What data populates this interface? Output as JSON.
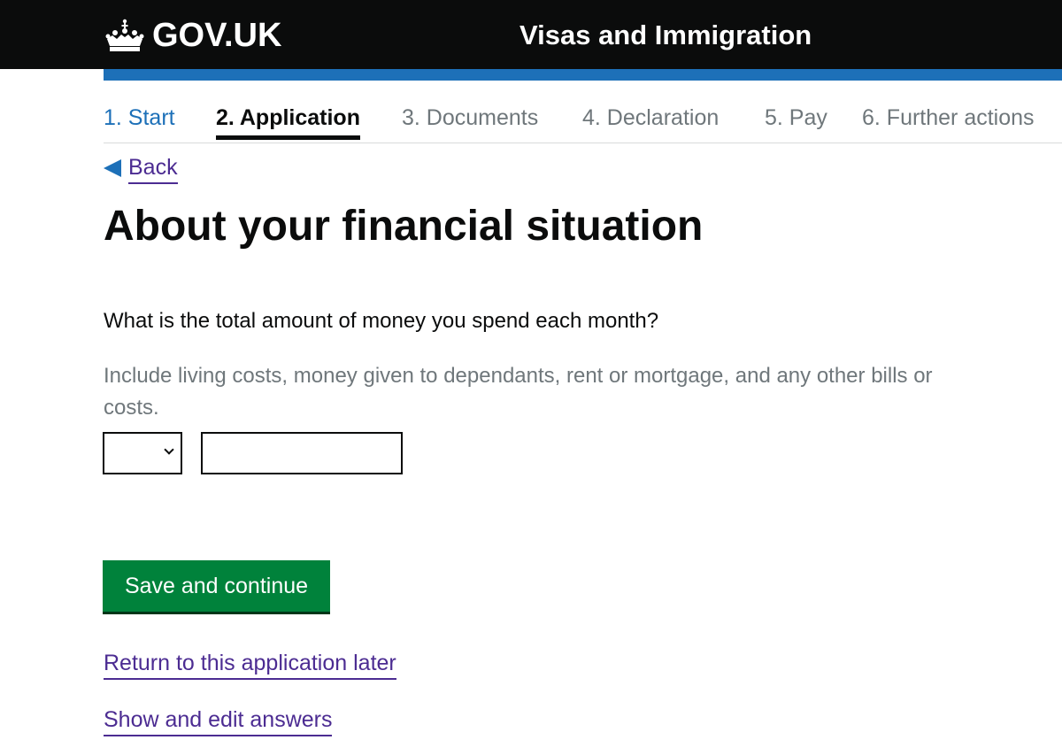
{
  "header": {
    "logo_text": "GOV.UK",
    "service_name": "Visas and Immigration"
  },
  "steps": [
    {
      "label": "1. Start",
      "state": "done"
    },
    {
      "label": "2. Application",
      "state": "current"
    },
    {
      "label": "3. Documents",
      "state": "upcoming"
    },
    {
      "label": "4. Declaration",
      "state": "upcoming"
    },
    {
      "label": "5. Pay",
      "state": "upcoming"
    },
    {
      "label": "6. Further actions",
      "state": "upcoming"
    }
  ],
  "back_link": {
    "label": "Back"
  },
  "page_title": "About your financial situation",
  "question": {
    "label": "What is the total amount of money you spend each month?",
    "hint": "Include living costs, money given to dependants, rent or mortgage, and any other bills or costs.",
    "currency_value": "",
    "amount_value": ""
  },
  "actions": {
    "save_label": "Save and continue",
    "return_later_label": "Return to this application later",
    "show_edit_label": "Show and edit answers"
  },
  "colors": {
    "header_bg": "#0b0c0c",
    "blue_bar": "#1d70b8",
    "button_green": "#00823b",
    "link_purple": "#4c2c92",
    "muted_grey": "#6f777b"
  },
  "icons": {
    "logo": "crown-icon",
    "back": "triangle-left-icon",
    "select": "chevron-down-icon"
  }
}
